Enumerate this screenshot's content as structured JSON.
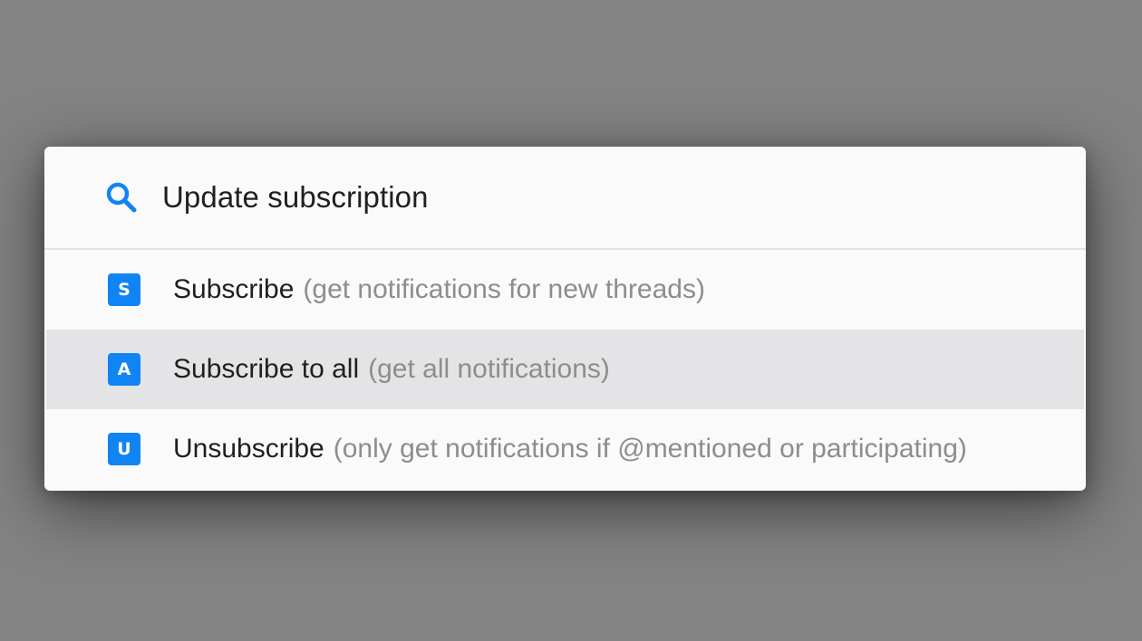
{
  "colors": {
    "backdrop": "#838383",
    "panel": "#fafafa",
    "accent": "#1184f3",
    "selected_row": "#e4e4e6",
    "label_text": "#1f1f1f",
    "hint_text": "#8d8d8d"
  },
  "search": {
    "icon": "search-icon",
    "value": "Update subscription"
  },
  "options": [
    {
      "key": "S",
      "label": "Subscribe",
      "description": "(get notifications for new threads)",
      "selected": false
    },
    {
      "key": "A",
      "label": "Subscribe to all",
      "description": "(get all notifications)",
      "selected": true
    },
    {
      "key": "U",
      "label": "Unsubscribe",
      "description": "(only get notifications if @mentioned or participating)",
      "selected": false
    }
  ]
}
